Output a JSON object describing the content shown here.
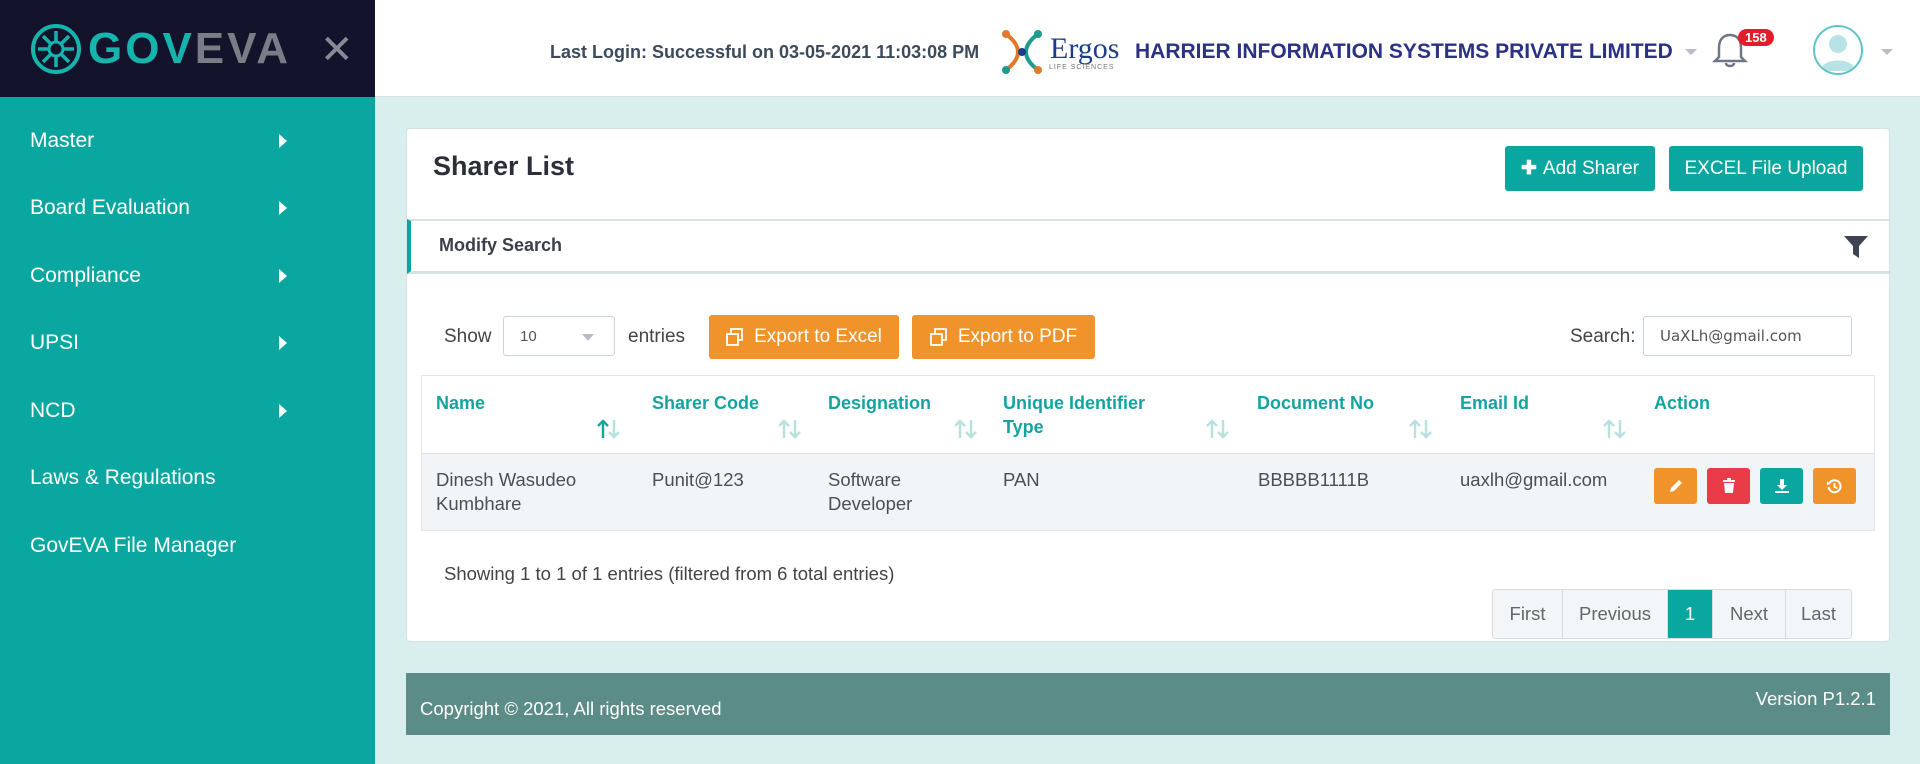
{
  "brand": {
    "gov": "GOV",
    "eva": "EVA"
  },
  "sidebar": {
    "items": [
      {
        "label": "Master",
        "has_submenu": true
      },
      {
        "label": "Board Evaluation",
        "has_submenu": true
      },
      {
        "label": "Compliance",
        "has_submenu": true
      },
      {
        "label": "UPSI",
        "has_submenu": true
      },
      {
        "label": "NCD",
        "has_submenu": true
      },
      {
        "label": "Laws & Regulations",
        "has_submenu": false
      },
      {
        "label": "GovEVA File Manager",
        "has_submenu": false
      }
    ]
  },
  "header": {
    "last_login": "Last Login: Successful on 03-05-2021 11:03:08 PM",
    "logo_word": "Ergos",
    "logo_sub": "LIFE SCIENCES",
    "company": "HARRIER INFORMATION SYSTEMS PRIVATE LIMITED",
    "notification_count": "158"
  },
  "page": {
    "title": "Sharer List",
    "add_button": "Add Sharer",
    "excel_upload_button": "EXCEL File Upload",
    "modify_search": "Modify Search"
  },
  "table_controls": {
    "show_label": "Show",
    "page_size": "10",
    "entries_label": "entries",
    "export_excel": "Export to Excel",
    "export_pdf": "Export to PDF",
    "search_label": "Search:",
    "search_value": "UaXLh@gmail.com"
  },
  "table": {
    "headers": {
      "name": "Name",
      "sharer_code": "Sharer Code",
      "designation": "Designation",
      "uid_type_1": "Unique Identifier",
      "uid_type_2": "Type",
      "document_no": "Document No",
      "email": "Email Id",
      "action": "Action"
    },
    "rows": [
      {
        "name_1": "Dinesh Wasudeo",
        "name_2": "Kumbhare",
        "sharer_code": "Punit@123",
        "designation_1": "Software",
        "designation_2": "Developer",
        "uid_type": "PAN",
        "document_no": "BBBBB1111B",
        "email": "uaxlh@gmail.com"
      }
    ],
    "info": "Showing 1 to 1 of 1 entries (filtered from 6 total entries)"
  },
  "pagination": {
    "first": "First",
    "previous": "Previous",
    "current": "1",
    "next": "Next",
    "last": "Last"
  },
  "footer": {
    "copyright": "Copyright © 2021, All rights reserved",
    "version": "Version P1.2.1"
  },
  "colors": {
    "primary_teal": "#0aa6a0",
    "sidebar_dark": "#13132b",
    "orange": "#f0932b",
    "red": "#ea3b48",
    "footer": "#5c8c88"
  },
  "icons": {
    "brand": "goveva-logo-icon",
    "close": "close-icon",
    "bell": "bell-icon",
    "avatar": "user-avatar-icon",
    "filter": "filter-icon",
    "copy": "copy-icon",
    "edit": "pencil-icon",
    "delete": "trash-icon",
    "download": "download-icon",
    "history": "history-icon"
  }
}
